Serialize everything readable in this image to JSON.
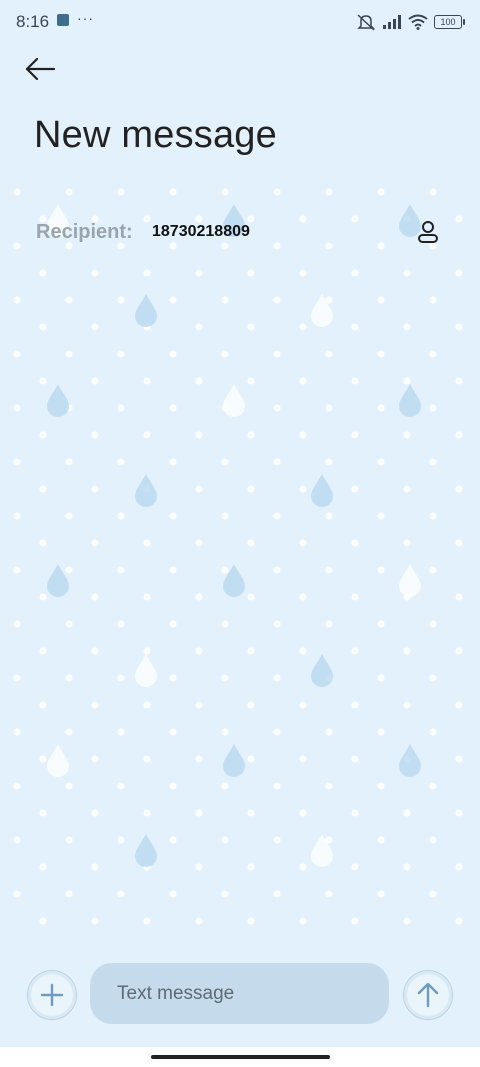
{
  "status_bar": {
    "time": "8:16",
    "dots": "···",
    "battery": "100",
    "icons": [
      "app-notification-icon",
      "mute-icon",
      "signal-icon",
      "wifi-icon",
      "battery-icon"
    ]
  },
  "header": {
    "back_icon": "arrow-left-icon",
    "title": "New message"
  },
  "recipient": {
    "label": "Recipient:",
    "number": "18730218809",
    "contact_icon": "person-icon"
  },
  "composer": {
    "attach_icon": "plus-icon",
    "placeholder": "Text message",
    "send_icon": "arrow-up-icon"
  },
  "theme": {
    "background": "#e2f1fb",
    "accent": "#6e9cc0",
    "input_bg": "#c5dbeb"
  }
}
